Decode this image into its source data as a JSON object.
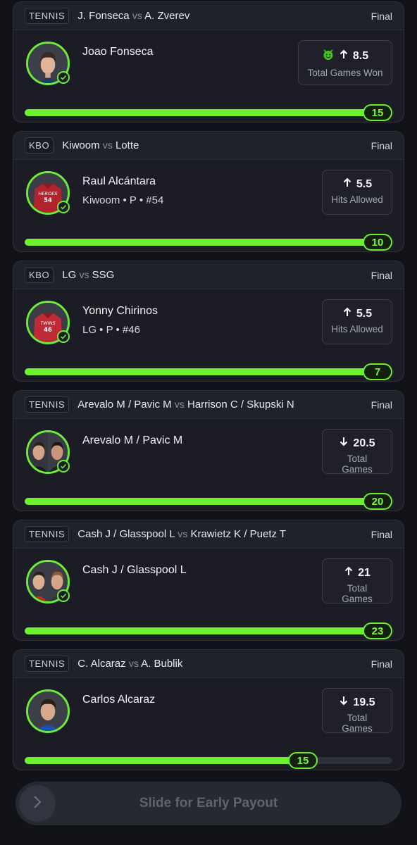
{
  "cards": [
    {
      "league": "TENNIS",
      "team_a": "J. Fonseca",
      "vs": "vs",
      "team_b": "A. Zverev",
      "status": "Final",
      "player": "Joao Fonseca",
      "sub": "",
      "direction": "up",
      "line": "8.5",
      "stat": "Total Games Won",
      "badge": "devil-emoji-icon",
      "result": "15",
      "progress": 1.0
    },
    {
      "league": "KBO",
      "team_a": "Kiwoom",
      "vs": "vs",
      "team_b": "Lotte",
      "status": "Final",
      "player": "Raul Alcántara",
      "sub": "Kiwoom • P • #54",
      "jersey_text": "HEROES",
      "jersey_number": "54",
      "direction": "up",
      "line": "5.5",
      "stat": "Hits Allowed",
      "result": "10",
      "progress": 1.0
    },
    {
      "league": "KBO",
      "team_a": "LG",
      "vs": "vs",
      "team_b": "SSG",
      "status": "Final",
      "player": "Yonny Chirinos",
      "sub": "LG • P • #46",
      "jersey_text": "TWINS",
      "jersey_number": "46",
      "direction": "up",
      "line": "5.5",
      "stat": "Hits Allowed",
      "result": "7",
      "progress": 1.0
    },
    {
      "league": "TENNIS",
      "team_a": "Arevalo M / Pavic M",
      "vs": "vs",
      "team_b": "Harrison C / Skupski N",
      "status": "Final",
      "player": "Arevalo M / Pavic M",
      "sub": "",
      "direction": "down",
      "line": "20.5",
      "stat": "Total Games",
      "result": "20",
      "progress": 1.0
    },
    {
      "league": "TENNIS",
      "team_a": "Cash J / Glasspool L",
      "vs": "vs",
      "team_b": "Krawietz K / Puetz T",
      "status": "Final",
      "player": "Cash J / Glasspool L",
      "sub": "",
      "direction": "up",
      "line": "21",
      "stat": "Total Games",
      "result": "23",
      "progress": 1.0
    },
    {
      "league": "TENNIS",
      "team_a": "C. Alcaraz",
      "vs": "vs",
      "team_b": "A. Bublik",
      "status": "Final",
      "player": "Carlos Alcaraz",
      "sub": "",
      "direction": "down",
      "line": "19.5",
      "stat": "Total Games",
      "result": "15",
      "progress": 0.77
    }
  ],
  "slider": {
    "label": "Slide for Early Payout"
  },
  "colors": {
    "accent": "#6df12c",
    "background": "#121319",
    "card": "#1b1c24"
  }
}
